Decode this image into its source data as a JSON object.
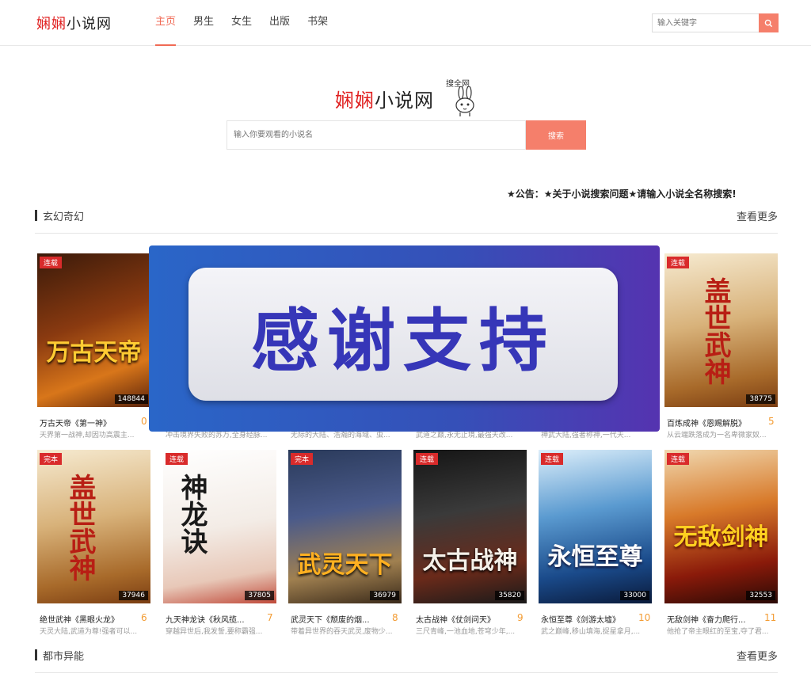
{
  "header": {
    "logo_red": "娴娴",
    "logo_black": "小说网",
    "nav": [
      "主页",
      "男生",
      "女生",
      "出版",
      "书架"
    ],
    "search_placeholder": "输入关键字"
  },
  "hero": {
    "logo_red": "娴娴",
    "logo_black": "小说网",
    "logo_tag": "搜全网",
    "search_placeholder": "输入你要观看的小说名",
    "search_button": "搜索"
  },
  "notice": "★公告：★关于小说搜索问题★请输入小说全名称搜索!",
  "sections": [
    {
      "title": "玄幻奇幻",
      "more": "查看更多"
    },
    {
      "title": "都市异能",
      "more": "查看更多"
    }
  ],
  "row1": [
    {
      "badge": "连载",
      "count": "148844",
      "cover_text": "万古天帝",
      "name": "万古天帝《第一神》",
      "rank": "0",
      "desc": "天界第一战神,却因功高震主..."
    },
    {
      "badge": "",
      "count": "",
      "cover_text": "",
      "name": "",
      "rank": "",
      "desc": "冲击境界失败的苏万,全身经脉..."
    },
    {
      "badge": "",
      "count": "",
      "cover_text": "",
      "name": "",
      "rank": "",
      "desc": "无际的大陆、浩瀚的海域、虫..."
    },
    {
      "badge": "",
      "count": "",
      "cover_text": "",
      "name": "",
      "rank": "",
      "desc": "武道之巅,永无止境,最强天改..."
    },
    {
      "badge": "",
      "count": "",
      "cover_text": "",
      "name": "",
      "rank": "",
      "desc": "神武大陆,强者称神,一代天..."
    },
    {
      "badge": "连载",
      "count": "38775",
      "cover_text": "盖世武神",
      "name": "百炼成神《恩赐解脱》",
      "rank": "5",
      "desc": "从云端跌落成为一名卑微家奴..."
    }
  ],
  "row2": [
    {
      "badge": "完本",
      "count": "37946",
      "cover_text": "盖世武神",
      "name": "绝世武神《黑眼火龙》",
      "rank": "6",
      "desc": "天灵大陆,武道为尊!强者可以..."
    },
    {
      "badge": "连载",
      "count": "37805",
      "cover_text": "神龙诀",
      "name": "九天神龙诀《秋风揽...",
      "rank": "7",
      "desc": "穿越异世后,我发誓,要称霸强..."
    },
    {
      "badge": "完本",
      "count": "36979",
      "cover_text": "武灵天下",
      "name": "武灵天下《颓废的烟...",
      "rank": "8",
      "desc": "带着异世界的吞天武灵,废物少..."
    },
    {
      "badge": "连载",
      "count": "35820",
      "cover_text": "太古战神",
      "name": "太古战神《仗剑问天》",
      "rank": "9",
      "desc": "三尺青峰,一池血地,苍穹少年,..."
    },
    {
      "badge": "连载",
      "count": "33000",
      "cover_text": "永恒至尊",
      "name": "永恒至尊《剑游太墟》",
      "rank": "10",
      "desc": "武之巅峰,移山填海,捉星拿月,..."
    },
    {
      "badge": "连载",
      "count": "32553",
      "cover_text": "无敌剑神",
      "name": "无敌剑神《奋力爬行...",
      "rank": "11",
      "desc": "他抢了帝主眼红的至宝,夺了君..."
    }
  ],
  "overlay_text": "感谢支持",
  "colors": {
    "accent": "#f57f6b",
    "brand_red": "#e02020",
    "badge": "#d92b2b",
    "rank": "#f39c34"
  }
}
